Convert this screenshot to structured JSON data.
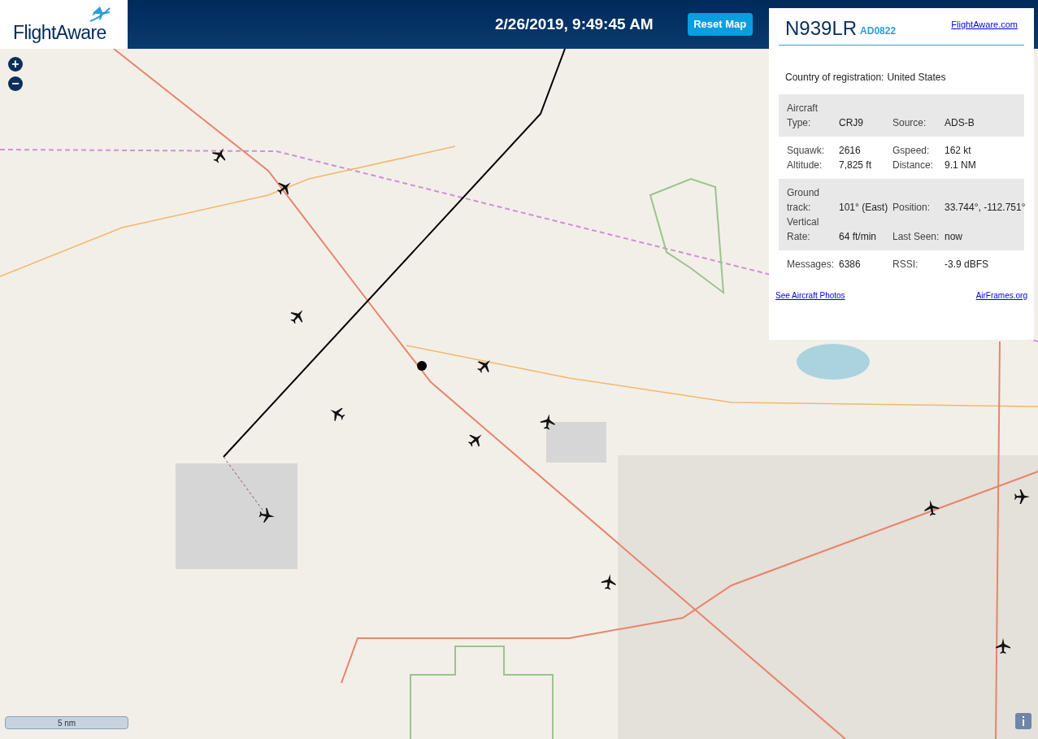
{
  "header": {
    "logo_text": "FlightAware",
    "datetime": "2/26/2019, 9:49:45 AM",
    "reset_button": "Reset Map"
  },
  "map_controls": {
    "zoom_in": "+",
    "zoom_out": "−"
  },
  "scale": {
    "label": "5 nm"
  },
  "panel": {
    "registration": "N939LR",
    "callsign": "AD0822",
    "link": "FlightAware.com",
    "country": {
      "label": "Country of registration:",
      "value": "United States"
    },
    "groups": [
      {
        "rows": [
          {
            "label": "Aircraft Type:",
            "value": "CRJ9",
            "label2": "Source:",
            "value2": "ADS-B"
          }
        ]
      },
      {
        "rows": [
          {
            "label": "Squawk:",
            "value": "2616",
            "label2": "Gspeed:",
            "value2": "162 kt"
          },
          {
            "label": "Altitude:",
            "value": "7,825 ft",
            "label2": "Distance:",
            "value2": "9.1 NM"
          }
        ]
      },
      {
        "rows": [
          {
            "label": "Ground track:",
            "value": "101° (East)",
            "label2": "Position:",
            "value2": "33.744°, -112.751°"
          },
          {
            "label": "Vertical Rate:",
            "value": "64 ft/min",
            "label2": "Last Seen:",
            "value2": "now"
          }
        ]
      },
      {
        "rows": [
          {
            "label": "Messages:",
            "value": "6386",
            "label2": "RSSI:",
            "value2": "-3.9 dBFS"
          }
        ]
      }
    ],
    "links": [
      "See Aircraft Photos",
      "AirFrames.org"
    ]
  }
}
